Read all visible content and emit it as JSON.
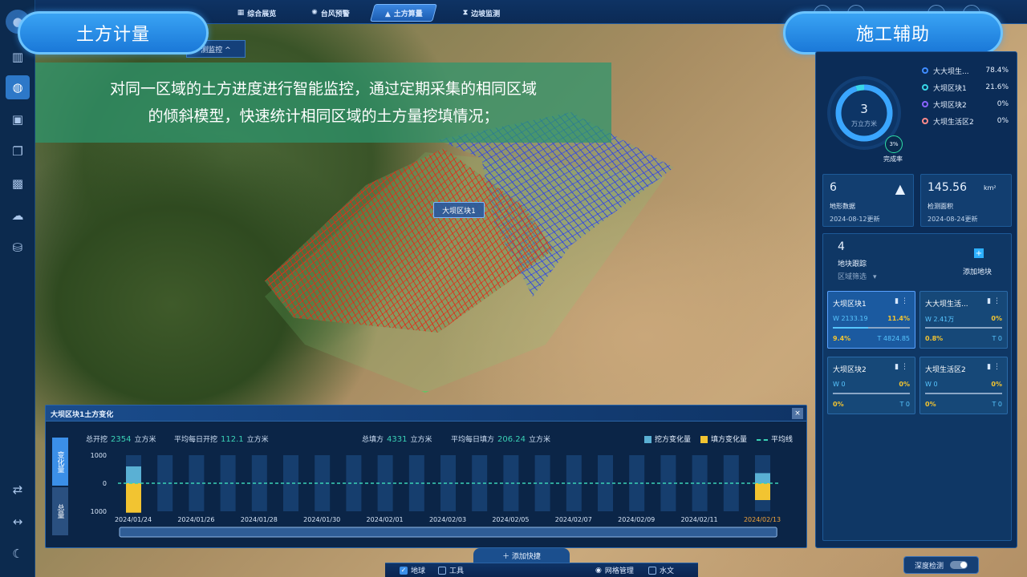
{
  "nav": {
    "tabs": [
      {
        "label": "综合展览",
        "icon": "grid-icon"
      },
      {
        "label": "台风预警",
        "icon": "typhoon-icon"
      },
      {
        "label": "土方算量",
        "icon": "triangle-icon",
        "active": true
      },
      {
        "label": "边坡监测",
        "icon": "slope-icon"
      }
    ]
  },
  "left_pill": {
    "label": "土方计量"
  },
  "right_pill": {
    "label": "施工辅助"
  },
  "monitor_tab": {
    "label": "测监控 ^"
  },
  "description": {
    "line1": "对同一区域的土方进度进行智能监控，通过定期采集的相同区域",
    "line2": "的倾斜模型，快速统计相同区域的土方量挖填情况；"
  },
  "map": {
    "region_label": "大坝区块1"
  },
  "donut": {
    "value": "3",
    "unit": "万立方米",
    "progress_pct": "3%",
    "progress_fraction": 0.03,
    "progress_label": "完成率",
    "legend": [
      {
        "name": "大大坝生...",
        "pct": "78.4%",
        "color": "#3f8cff"
      },
      {
        "name": "大坝区块1",
        "pct": "21.6%",
        "color": "#38d6e8"
      },
      {
        "name": "大坝区块2",
        "pct": "0%",
        "color": "#8a63ff"
      },
      {
        "name": "大坝生活区2",
        "pct": "0%",
        "color": "#ff8a8a"
      }
    ]
  },
  "stats": {
    "terrain": {
      "value": "6",
      "label": "地形数据",
      "date": "2024-08-12更新"
    },
    "area": {
      "value": "145.56",
      "unit": "km²",
      "label": "检测面积",
      "date": "2024-08-24更新"
    }
  },
  "plots": {
    "count": "4",
    "label": "地块跟踪",
    "filter": "区域筛选",
    "add_label": "添加地块",
    "cards": [
      {
        "title": "大坝区块1",
        "w": "W 2133.19",
        "pct": "11.4%",
        "fill": 0.114,
        "pct2": "9.4%",
        "t": "T 4824.85",
        "selected": true
      },
      {
        "title": "大大坝生活...",
        "w": "W 2.41万",
        "pct": "0%",
        "fill": 0,
        "pct2": "0.8%",
        "t": "T 0",
        "selected": false
      },
      {
        "title": "大坝区块2",
        "w": "W 0",
        "pct": "0%",
        "fill": 0,
        "pct2": "0%",
        "t": "T 0",
        "selected": false
      },
      {
        "title": "大坝生活区2",
        "w": "W 0",
        "pct": "0%",
        "fill": 0,
        "pct2": "0%",
        "t": "T 0",
        "selected": false
      }
    ]
  },
  "chart_panel": {
    "title": "大坝区块1土方变化",
    "close": "×",
    "stats": [
      {
        "label": "总开挖",
        "value": "2354",
        "unit": "立方米"
      },
      {
        "label": "平均每日开挖",
        "value": "112.1",
        "unit": "立方米"
      },
      {
        "label": "总填方",
        "value": "4331",
        "unit": "立方米"
      },
      {
        "label": "平均每日填方",
        "value": "206.24",
        "unit": "立方米"
      }
    ],
    "tabs": [
      "变化量",
      "总量"
    ],
    "add_shortcut": "＋ 添加快捷"
  },
  "chart_data": {
    "type": "bar",
    "legend": [
      "挖方变化量",
      "填方变化量",
      "平均线"
    ],
    "colors": {
      "excavation": "#5ab0d4",
      "fill": "#f2c431",
      "avg": "#3ad2b6"
    },
    "y_ticks": [
      "1000",
      "0",
      "1000"
    ],
    "ylim": [
      -1000,
      1000
    ],
    "x_labels": [
      "2024/01/24",
      "2024/01/26",
      "2024/01/28",
      "2024/01/30",
      "2024/02/01",
      "2024/02/03",
      "2024/02/05",
      "2024/02/07",
      "2024/02/09",
      "2024/02/11",
      "2024/02/13"
    ],
    "highlight_label": "2024/02/13",
    "slots": 21,
    "series": [
      {
        "name": "挖方变化量",
        "values": [
          600,
          0,
          0,
          0,
          0,
          0,
          0,
          0,
          0,
          0,
          0,
          0,
          0,
          0,
          0,
          0,
          0,
          0,
          0,
          0,
          360
        ]
      },
      {
        "name": "填方变化量",
        "values": [
          -1050,
          0,
          0,
          0,
          0,
          0,
          0,
          0,
          0,
          0,
          0,
          0,
          0,
          0,
          0,
          0,
          0,
          0,
          0,
          0,
          -600
        ]
      }
    ]
  },
  "footer": {
    "earth": "地球",
    "tools": "工具",
    "grid": "网格管理",
    "water": "水文",
    "depth": "深度检测"
  }
}
